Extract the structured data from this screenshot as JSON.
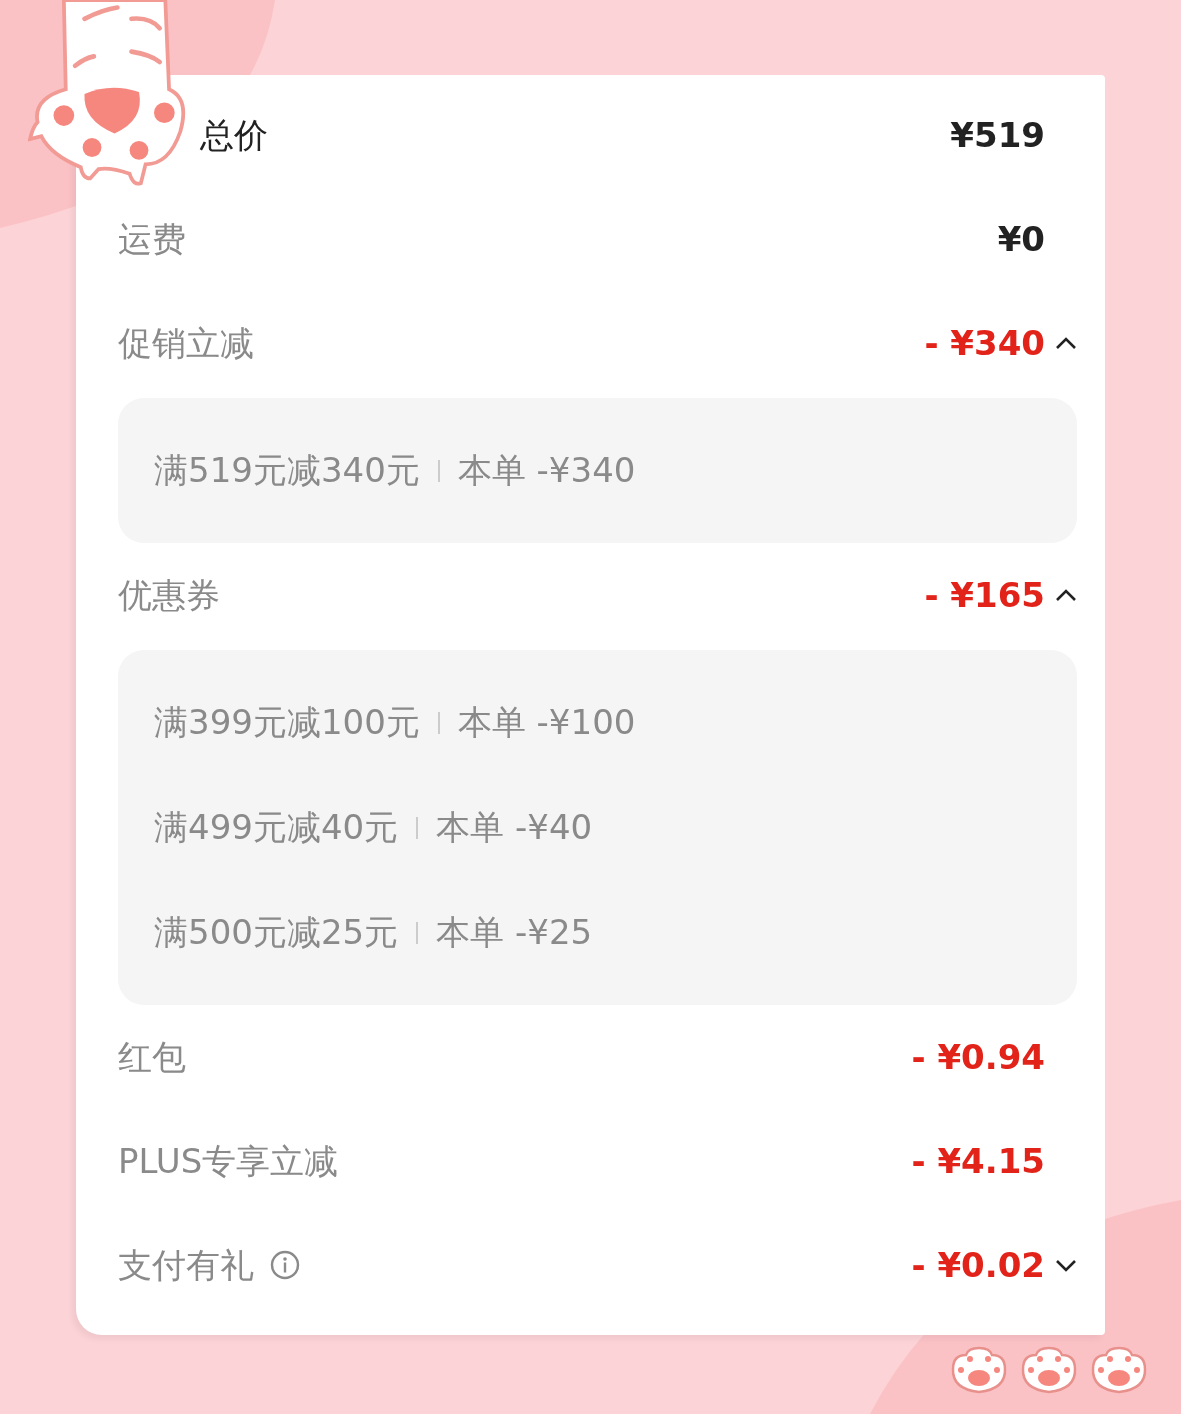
{
  "rows": [
    {
      "label": "总价",
      "amount": "¥519",
      "kind": "total"
    },
    {
      "label": "运费",
      "amount": "¥0",
      "kind": "fee"
    },
    {
      "label": "促销立减",
      "amount": "- ¥340",
      "kind": "discount",
      "expanded": true,
      "details": [
        {
          "rule": "满519元减340元",
          "this_order": "本单 -¥340"
        }
      ]
    },
    {
      "label": "优惠券",
      "amount": "- ¥165",
      "kind": "discount",
      "expanded": true,
      "details": [
        {
          "rule": "满399元减100元",
          "this_order": "本单 -¥100"
        },
        {
          "rule": "满499元减40元",
          "this_order": "本单 -¥40"
        },
        {
          "rule": "满500元减25元",
          "this_order": "本单 -¥25"
        }
      ]
    },
    {
      "label": "红包",
      "amount": "- ¥0.94",
      "kind": "discount"
    },
    {
      "label": "PLUS专享立减",
      "amount": "- ¥4.15",
      "kind": "discount"
    },
    {
      "label": "支付有礼",
      "amount": "- ¥0.02",
      "kind": "discount",
      "info": true,
      "expanded": false
    }
  ]
}
